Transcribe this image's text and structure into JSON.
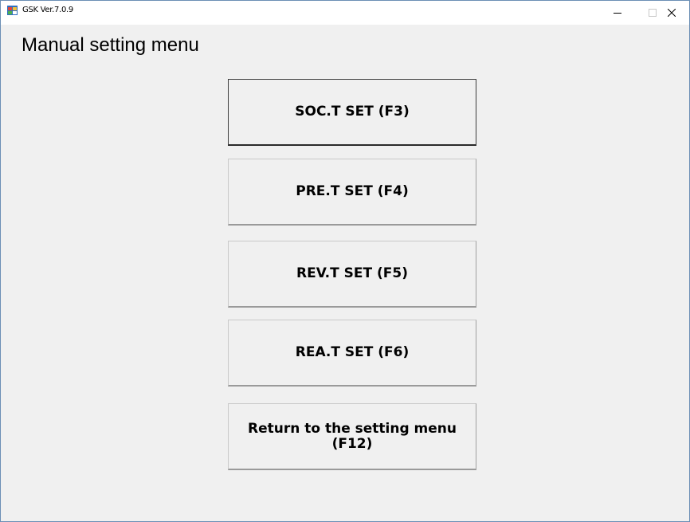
{
  "window": {
    "title": "GSK Ver.7.0.9",
    "controls": {
      "minimize": "–",
      "maximize": "□",
      "close": "✕"
    }
  },
  "page": {
    "heading": "Manual setting menu"
  },
  "buttons": [
    {
      "label": "SOC.T SET (F3)"
    },
    {
      "label": "PRE.T SET (F4)"
    },
    {
      "label": "REV.T SET (F5)"
    },
    {
      "label": "REA.T SET (F6)"
    },
    {
      "label": "Return to the setting menu (F12)"
    }
  ]
}
